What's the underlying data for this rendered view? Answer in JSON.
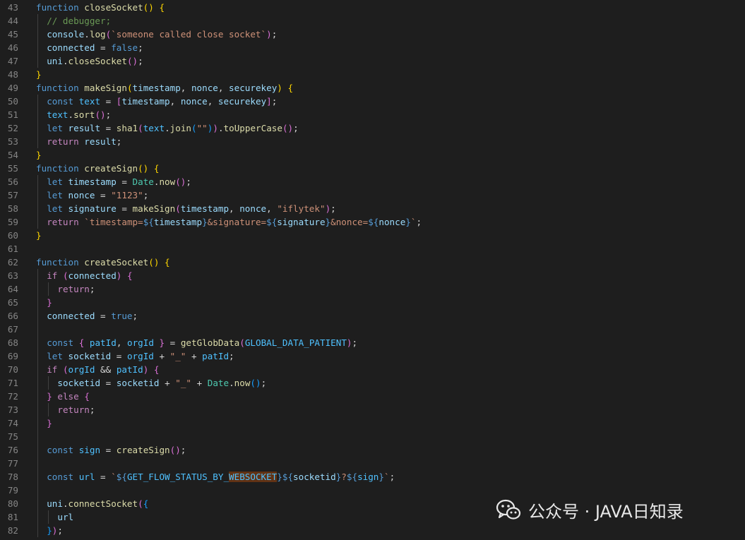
{
  "editor": {
    "language": "javascript",
    "theme": "dark",
    "lines": [
      {
        "n": "43",
        "indent": 0,
        "tokens": [
          [
            "kw",
            "function"
          ],
          [
            "pl",
            " "
          ],
          [
            "fn",
            "closeSocket"
          ],
          [
            "b1",
            "()"
          ],
          [
            "pl",
            " "
          ],
          [
            "b1",
            "{"
          ]
        ]
      },
      {
        "n": "44",
        "indent": 1,
        "tokens": [
          [
            "cm",
            "// debugger;"
          ]
        ]
      },
      {
        "n": "45",
        "indent": 1,
        "tokens": [
          [
            "vr",
            "console"
          ],
          [
            "pl",
            "."
          ],
          [
            "fn",
            "log"
          ],
          [
            "b2",
            "("
          ],
          [
            "str",
            "`someone called close socket`"
          ],
          [
            "b2",
            ")"
          ],
          [
            "pl",
            ";"
          ]
        ]
      },
      {
        "n": "46",
        "indent": 1,
        "tokens": [
          [
            "vr",
            "connected"
          ],
          [
            "pl",
            " = "
          ],
          [
            "kw",
            "false"
          ],
          [
            "pl",
            ";"
          ]
        ]
      },
      {
        "n": "47",
        "indent": 1,
        "tokens": [
          [
            "vr",
            "uni"
          ],
          [
            "pl",
            "."
          ],
          [
            "fn",
            "closeSocket"
          ],
          [
            "b2",
            "()"
          ],
          [
            "pl",
            ";"
          ]
        ]
      },
      {
        "n": "48",
        "indent": 0,
        "tokens": [
          [
            "b1",
            "}"
          ]
        ]
      },
      {
        "n": "49",
        "indent": 0,
        "tokens": [
          [
            "kw",
            "function"
          ],
          [
            "pl",
            " "
          ],
          [
            "fn",
            "makeSign"
          ],
          [
            "b1",
            "("
          ],
          [
            "vr",
            "timestamp"
          ],
          [
            "pl",
            ", "
          ],
          [
            "vr",
            "nonce"
          ],
          [
            "pl",
            ", "
          ],
          [
            "vr",
            "securekey"
          ],
          [
            "b1",
            ")"
          ],
          [
            "pl",
            " "
          ],
          [
            "b1",
            "{"
          ]
        ]
      },
      {
        "n": "50",
        "indent": 1,
        "tokens": [
          [
            "kw",
            "const"
          ],
          [
            "pl",
            " "
          ],
          [
            "cst",
            "text"
          ],
          [
            "pl",
            " = "
          ],
          [
            "b2",
            "["
          ],
          [
            "vr",
            "timestamp"
          ],
          [
            "pl",
            ", "
          ],
          [
            "vr",
            "nonce"
          ],
          [
            "pl",
            ", "
          ],
          [
            "vr",
            "securekey"
          ],
          [
            "b2",
            "]"
          ],
          [
            "pl",
            ";"
          ]
        ]
      },
      {
        "n": "51",
        "indent": 1,
        "tokens": [
          [
            "cst",
            "text"
          ],
          [
            "pl",
            "."
          ],
          [
            "fn",
            "sort"
          ],
          [
            "b2",
            "()"
          ],
          [
            "pl",
            ";"
          ]
        ]
      },
      {
        "n": "52",
        "indent": 1,
        "tokens": [
          [
            "kw",
            "let"
          ],
          [
            "pl",
            " "
          ],
          [
            "vr",
            "result"
          ],
          [
            "pl",
            " = "
          ],
          [
            "fn",
            "sha1"
          ],
          [
            "b2",
            "("
          ],
          [
            "cst",
            "text"
          ],
          [
            "pl",
            "."
          ],
          [
            "fn",
            "join"
          ],
          [
            "b3",
            "("
          ],
          [
            "str",
            "\"\""
          ],
          [
            "b3",
            ")"
          ],
          [
            "b2",
            ")"
          ],
          [
            "pl",
            "."
          ],
          [
            "fn",
            "toUpperCase"
          ],
          [
            "b2",
            "()"
          ],
          [
            "pl",
            ";"
          ]
        ]
      },
      {
        "n": "53",
        "indent": 1,
        "tokens": [
          [
            "ctl",
            "return"
          ],
          [
            "pl",
            " "
          ],
          [
            "vr",
            "result"
          ],
          [
            "pl",
            ";"
          ]
        ]
      },
      {
        "n": "54",
        "indent": 0,
        "tokens": [
          [
            "b1",
            "}"
          ]
        ]
      },
      {
        "n": "55",
        "indent": 0,
        "tokens": [
          [
            "kw",
            "function"
          ],
          [
            "pl",
            " "
          ],
          [
            "fn",
            "createSign"
          ],
          [
            "b1",
            "()"
          ],
          [
            "pl",
            " "
          ],
          [
            "b1",
            "{"
          ]
        ]
      },
      {
        "n": "56",
        "indent": 1,
        "tokens": [
          [
            "kw",
            "let"
          ],
          [
            "pl",
            " "
          ],
          [
            "vr",
            "timestamp"
          ],
          [
            "pl",
            " = "
          ],
          [
            "cls",
            "Date"
          ],
          [
            "pl",
            "."
          ],
          [
            "fn",
            "now"
          ],
          [
            "b2",
            "()"
          ],
          [
            "pl",
            ";"
          ]
        ]
      },
      {
        "n": "57",
        "indent": 1,
        "tokens": [
          [
            "kw",
            "let"
          ],
          [
            "pl",
            " "
          ],
          [
            "vr",
            "nonce"
          ],
          [
            "pl",
            " = "
          ],
          [
            "str",
            "\"1123\""
          ],
          [
            "pl",
            ";"
          ]
        ]
      },
      {
        "n": "58",
        "indent": 1,
        "tokens": [
          [
            "kw",
            "let"
          ],
          [
            "pl",
            " "
          ],
          [
            "vr",
            "signature"
          ],
          [
            "pl",
            " = "
          ],
          [
            "fn",
            "makeSign"
          ],
          [
            "b2",
            "("
          ],
          [
            "vr",
            "timestamp"
          ],
          [
            "pl",
            ", "
          ],
          [
            "vr",
            "nonce"
          ],
          [
            "pl",
            ", "
          ],
          [
            "str",
            "\"iflytek\""
          ],
          [
            "b2",
            ")"
          ],
          [
            "pl",
            ";"
          ]
        ]
      },
      {
        "n": "59",
        "indent": 1,
        "tokens": [
          [
            "ctl",
            "return"
          ],
          [
            "pl",
            " "
          ],
          [
            "str",
            "`timestamp="
          ],
          [
            "kw",
            "${"
          ],
          [
            "vr",
            "timestamp"
          ],
          [
            "kw",
            "}"
          ],
          [
            "str",
            "&signature="
          ],
          [
            "kw",
            "${"
          ],
          [
            "vr",
            "signature"
          ],
          [
            "kw",
            "}"
          ],
          [
            "str",
            "&nonce="
          ],
          [
            "kw",
            "${"
          ],
          [
            "vr",
            "nonce"
          ],
          [
            "kw",
            "}"
          ],
          [
            "str",
            "`"
          ],
          [
            "pl",
            ";"
          ]
        ]
      },
      {
        "n": "60",
        "indent": 0,
        "tokens": [
          [
            "b1",
            "}"
          ]
        ]
      },
      {
        "n": "61",
        "indent": 0,
        "tokens": []
      },
      {
        "n": "62",
        "indent": 0,
        "tokens": [
          [
            "kw",
            "function"
          ],
          [
            "pl",
            " "
          ],
          [
            "fn",
            "createSocket"
          ],
          [
            "b1",
            "()"
          ],
          [
            "pl",
            " "
          ],
          [
            "b1",
            "{"
          ]
        ]
      },
      {
        "n": "63",
        "indent": 1,
        "tokens": [
          [
            "ctl",
            "if"
          ],
          [
            "pl",
            " "
          ],
          [
            "b2",
            "("
          ],
          [
            "vr",
            "connected"
          ],
          [
            "b2",
            ")"
          ],
          [
            "pl",
            " "
          ],
          [
            "b2",
            "{"
          ]
        ]
      },
      {
        "n": "64",
        "indent": 2,
        "tokens": [
          [
            "ctl",
            "return"
          ],
          [
            "pl",
            ";"
          ]
        ]
      },
      {
        "n": "65",
        "indent": 1,
        "tokens": [
          [
            "b2",
            "}"
          ]
        ]
      },
      {
        "n": "66",
        "indent": 1,
        "tokens": [
          [
            "vr",
            "connected"
          ],
          [
            "pl",
            " = "
          ],
          [
            "kw",
            "true"
          ],
          [
            "pl",
            ";"
          ]
        ]
      },
      {
        "n": "67",
        "indent": 1,
        "tokens": []
      },
      {
        "n": "68",
        "indent": 1,
        "tokens": [
          [
            "kw",
            "const"
          ],
          [
            "pl",
            " "
          ],
          [
            "b2",
            "{"
          ],
          [
            "pl",
            " "
          ],
          [
            "cst",
            "patId"
          ],
          [
            "pl",
            ", "
          ],
          [
            "cst",
            "orgId"
          ],
          [
            "pl",
            " "
          ],
          [
            "b2",
            "}"
          ],
          [
            "pl",
            " = "
          ],
          [
            "fn",
            "getGlobData"
          ],
          [
            "b2",
            "("
          ],
          [
            "cst",
            "GLOBAL_DATA_PATIENT"
          ],
          [
            "b2",
            ")"
          ],
          [
            "pl",
            ";"
          ]
        ]
      },
      {
        "n": "69",
        "indent": 1,
        "tokens": [
          [
            "kw",
            "let"
          ],
          [
            "pl",
            " "
          ],
          [
            "vr",
            "socketid"
          ],
          [
            "pl",
            " = "
          ],
          [
            "cst",
            "orgId"
          ],
          [
            "pl",
            " + "
          ],
          [
            "str",
            "\"_\""
          ],
          [
            "pl",
            " + "
          ],
          [
            "cst",
            "patId"
          ],
          [
            "pl",
            ";"
          ]
        ]
      },
      {
        "n": "70",
        "indent": 1,
        "tokens": [
          [
            "ctl",
            "if"
          ],
          [
            "pl",
            " "
          ],
          [
            "b2",
            "("
          ],
          [
            "cst",
            "orgId"
          ],
          [
            "pl",
            " && "
          ],
          [
            "cst",
            "patId"
          ],
          [
            "b2",
            ")"
          ],
          [
            "pl",
            " "
          ],
          [
            "b2",
            "{"
          ]
        ]
      },
      {
        "n": "71",
        "indent": 2,
        "tokens": [
          [
            "vr",
            "socketid"
          ],
          [
            "pl",
            " = "
          ],
          [
            "vr",
            "socketid"
          ],
          [
            "pl",
            " + "
          ],
          [
            "str",
            "\"_\""
          ],
          [
            "pl",
            " + "
          ],
          [
            "cls",
            "Date"
          ],
          [
            "pl",
            "."
          ],
          [
            "fn",
            "now"
          ],
          [
            "b3",
            "()"
          ],
          [
            "pl",
            ";"
          ]
        ]
      },
      {
        "n": "72",
        "indent": 1,
        "tokens": [
          [
            "b2",
            "}"
          ],
          [
            "pl",
            " "
          ],
          [
            "ctl",
            "else"
          ],
          [
            "pl",
            " "
          ],
          [
            "b2",
            "{"
          ]
        ]
      },
      {
        "n": "73",
        "indent": 2,
        "tokens": [
          [
            "ctl",
            "return"
          ],
          [
            "pl",
            ";"
          ]
        ]
      },
      {
        "n": "74",
        "indent": 1,
        "tokens": [
          [
            "b2",
            "}"
          ]
        ]
      },
      {
        "n": "75",
        "indent": 1,
        "tokens": []
      },
      {
        "n": "76",
        "indent": 1,
        "tokens": [
          [
            "kw",
            "const"
          ],
          [
            "pl",
            " "
          ],
          [
            "cst",
            "sign"
          ],
          [
            "pl",
            " = "
          ],
          [
            "fn",
            "createSign"
          ],
          [
            "b2",
            "()"
          ],
          [
            "pl",
            ";"
          ]
        ]
      },
      {
        "n": "77",
        "indent": 1,
        "tokens": []
      },
      {
        "n": "78",
        "indent": 1,
        "tokens": [
          [
            "kw",
            "const"
          ],
          [
            "pl",
            " "
          ],
          [
            "cst",
            "url"
          ],
          [
            "pl",
            " = "
          ],
          [
            "str",
            "`"
          ],
          [
            "kw",
            "${"
          ],
          [
            "cst",
            "GET_FLOW_STATUS_BY_"
          ],
          [
            "cst hl",
            "WEBSOCKET"
          ],
          [
            "kw",
            "}${"
          ],
          [
            "vr",
            "socketid"
          ],
          [
            "kw",
            "}"
          ],
          [
            "str",
            "?"
          ],
          [
            "kw",
            "${"
          ],
          [
            "cst",
            "sign"
          ],
          [
            "kw",
            "}"
          ],
          [
            "str",
            "`"
          ],
          [
            "pl",
            ";"
          ]
        ]
      },
      {
        "n": "79",
        "indent": 1,
        "tokens": []
      },
      {
        "n": "80",
        "indent": 1,
        "tokens": [
          [
            "vr",
            "uni"
          ],
          [
            "pl",
            "."
          ],
          [
            "fn",
            "connectSocket"
          ],
          [
            "b2",
            "("
          ],
          [
            "b3",
            "{"
          ]
        ]
      },
      {
        "n": "81",
        "indent": 2,
        "tokens": [
          [
            "vr",
            "url"
          ]
        ]
      },
      {
        "n": "82",
        "indent": 1,
        "tokens": [
          [
            "b3",
            "}"
          ],
          [
            "b2",
            ")"
          ],
          [
            "pl",
            ";"
          ]
        ]
      }
    ]
  },
  "watermark": {
    "text": "公众号 · JAVA日知录",
    "icon": "wechat-icon"
  }
}
